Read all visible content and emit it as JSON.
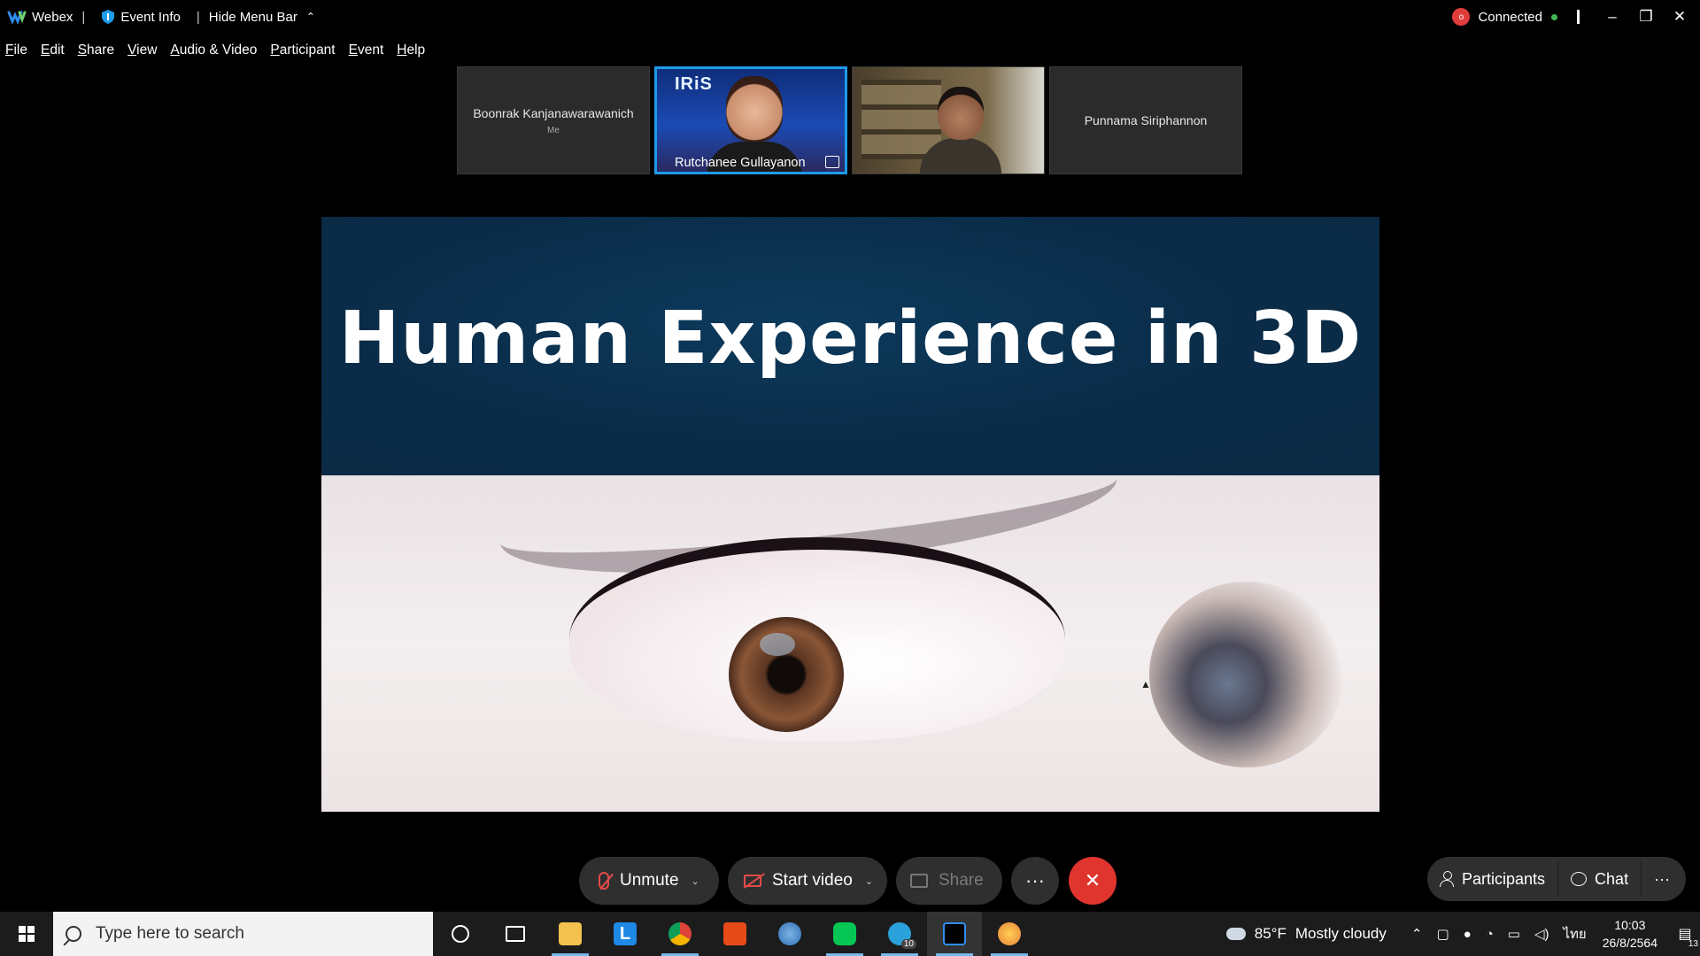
{
  "titlebar": {
    "app_name": "Webex",
    "event_info": "Event Info",
    "hide_menu": "Hide Menu Bar",
    "status": "Connected",
    "rec_badge": "o"
  },
  "menu": [
    "File",
    "Edit",
    "Share",
    "View",
    "Audio & Video",
    "Participant",
    "Event",
    "Help"
  ],
  "participants": {
    "p1_name": "Boonrak Kanjanawarawanich",
    "p1_sub": "Me",
    "p2_name": "Rutchanee Gullayanon",
    "p2_logo": "IRiS",
    "p4_name": "Punnama Siriphannon"
  },
  "slide": {
    "title": "Human Experience in 3D"
  },
  "controls": {
    "unmute": "Unmute",
    "start_video": "Start video",
    "share": "Share",
    "more": "···",
    "end": "✕",
    "participants": "Participants",
    "chat": "Chat",
    "side_more": "···"
  },
  "taskbar": {
    "search_placeholder": "Type here to search",
    "weather_temp": "85°F",
    "weather_desc": "Mostly cloudy",
    "lang": "ไทย",
    "time": "10:03",
    "date": "26/8/2564",
    "telegram_badge": "10",
    "notif_count": "13"
  },
  "colors": {
    "accent": "#1e9be9",
    "end_call": "#e0352e",
    "muted_red": "#e24a4a",
    "connected_green": "#3fb950"
  }
}
